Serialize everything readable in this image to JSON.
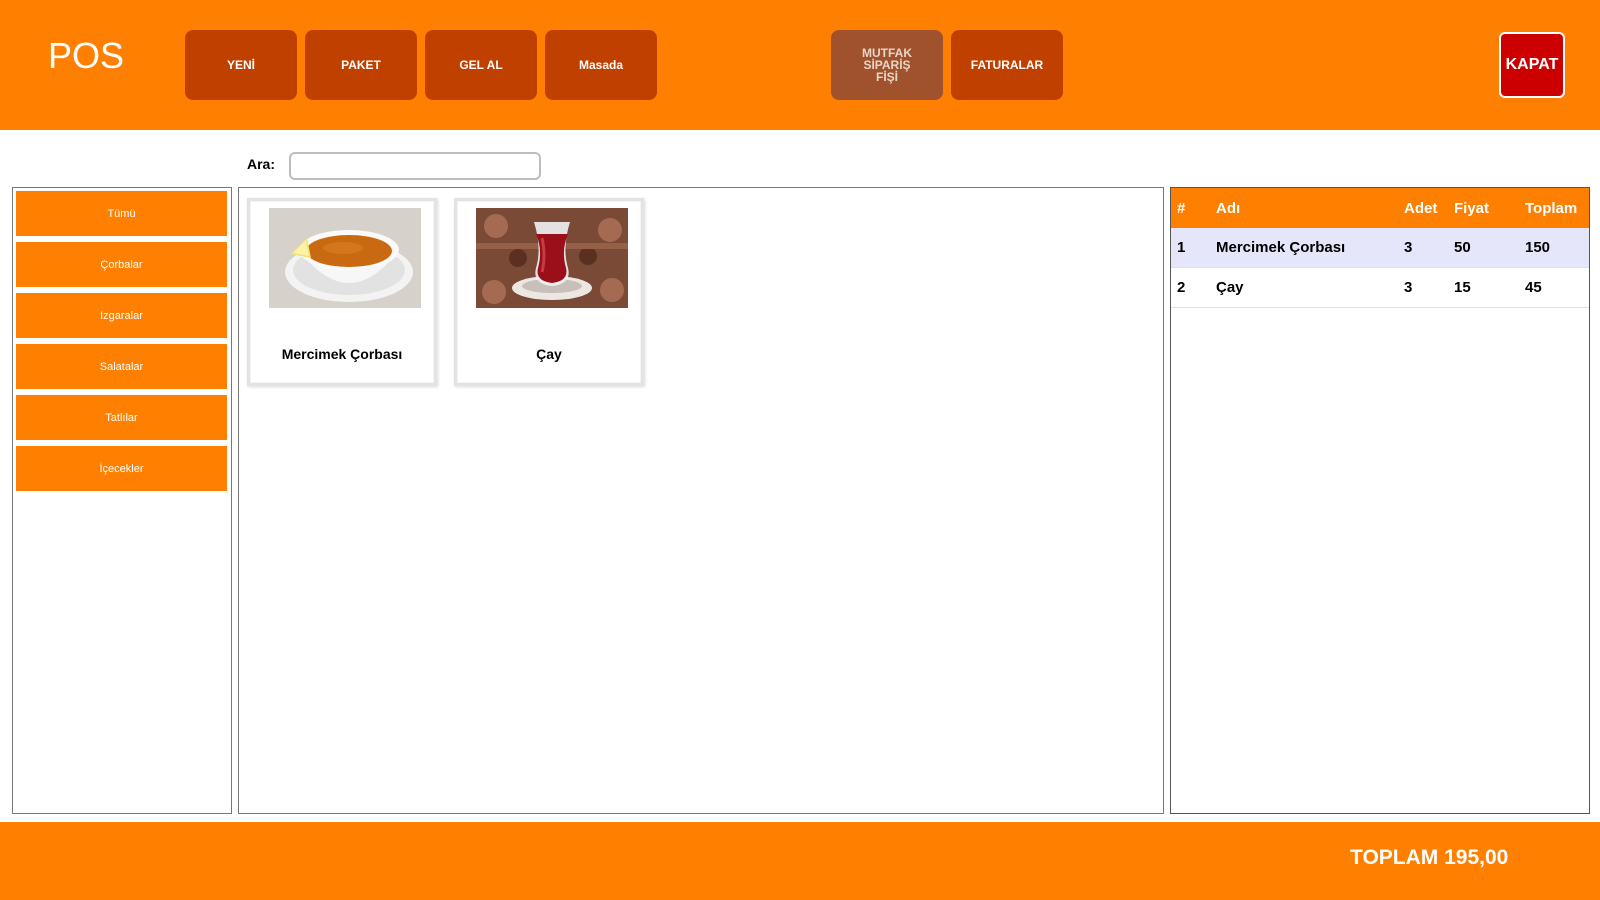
{
  "header": {
    "title": "POS",
    "buttons": {
      "yeni": "YENİ",
      "paket": "PAKET",
      "gel_al": "GEL AL",
      "masada": "Masada",
      "mutfak": "MUTFAK\nSİPARİŞ\nFİŞİ",
      "faturalar": "FATURALAR"
    },
    "close": "KAPAT"
  },
  "search": {
    "label": "Ara:",
    "value": "",
    "placeholder": ""
  },
  "categories": [
    "Tümü",
    "Çorbalar",
    "Izgaralar",
    "Salatalar",
    "Tatlılar",
    "İçecekler"
  ],
  "products": [
    {
      "name": "Mercimek Çorbası",
      "image": "soup-bowl"
    },
    {
      "name": "Çay",
      "image": "turkish-tea-glass"
    }
  ],
  "order": {
    "headers": {
      "no": "#",
      "name": "Adı",
      "qty": "Adet",
      "price": "Fiyat",
      "total": "Toplam"
    },
    "rows": [
      {
        "no": "1",
        "name": "Mercimek Çorbası",
        "qty": "3",
        "price": "50",
        "total": "150"
      },
      {
        "no": "2",
        "name": "Çay",
        "qty": "3",
        "price": "15",
        "total": "45"
      }
    ]
  },
  "footer": {
    "total": "TOPLAM 195,00"
  },
  "colors": {
    "primary": "#ff7f00",
    "button": "#c04000",
    "button_disabled": "#a0522d",
    "close": "#cc0000",
    "selected_row": "#e6e6fa"
  }
}
